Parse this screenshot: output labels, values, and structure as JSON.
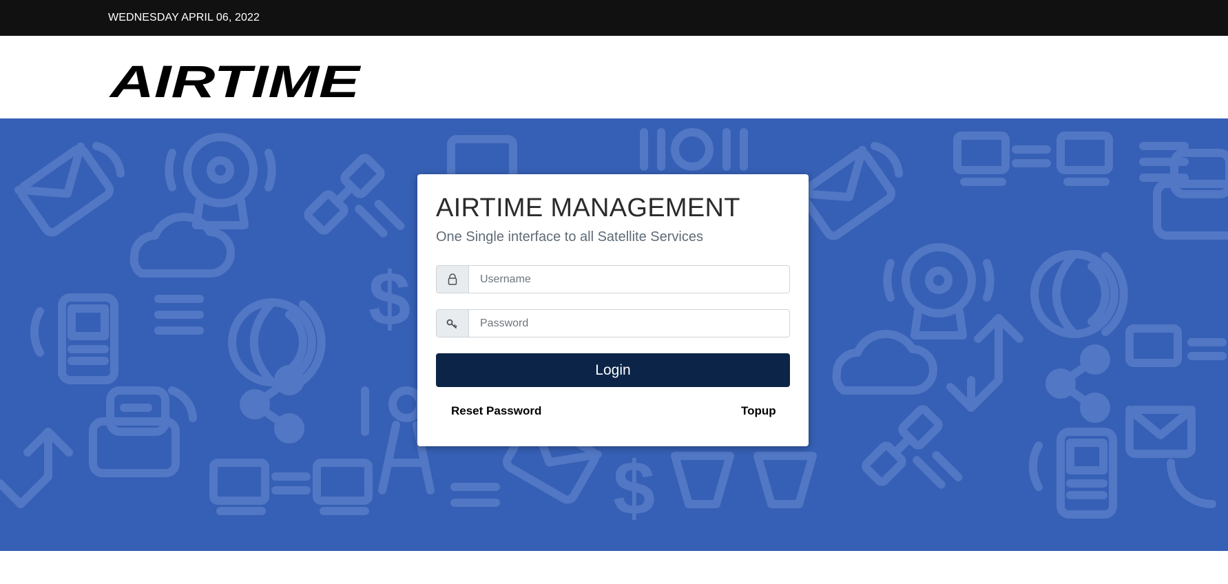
{
  "topbar": {
    "date": "WEDNESDAY APRIL 06, 2022"
  },
  "header": {
    "logo_text": "AIRTIME"
  },
  "login": {
    "title": "AIRTIME MANAGEMENT",
    "subtitle": "One Single interface to all Satellite Services",
    "username_placeholder": "Username",
    "password_placeholder": "Password",
    "username_value": "",
    "password_value": "",
    "login_label": "Login",
    "reset_password_label": "Reset Password",
    "topup_label": "Topup"
  },
  "icons": {
    "username": "user-lock-icon",
    "password": "key-icon"
  },
  "colors": {
    "topbar_bg": "#111111",
    "hero_bg": "#3660b5",
    "pattern": "#5277c4",
    "button_bg": "#0b2447"
  }
}
